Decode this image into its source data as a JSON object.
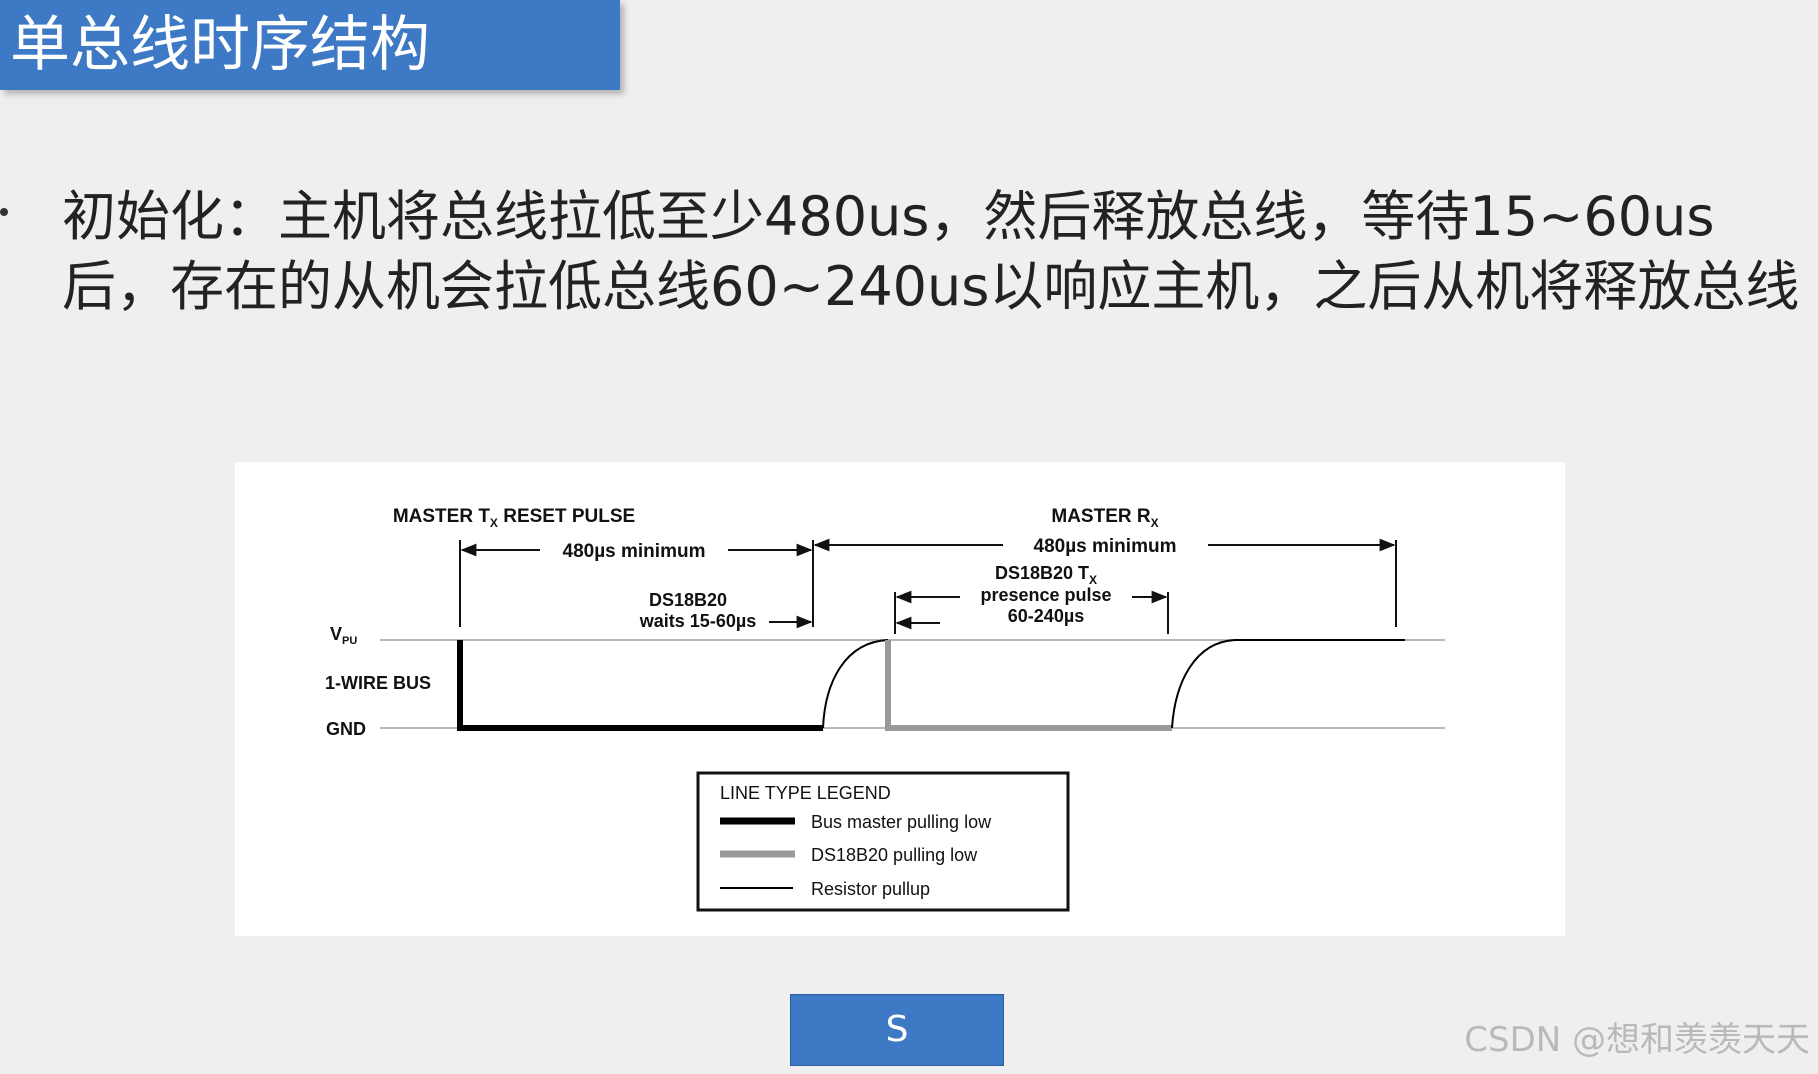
{
  "slide": {
    "title": "单总线时序结构",
    "bullet_text": "初始化：主机将总线拉低至少480us，然后释放总线，等待15~60us后，存在的从机会拉低总线60~240us以响应主机，之后从机将释放总线"
  },
  "diagram": {
    "master_tx_reset_label": "MASTER T",
    "master_tx_reset_sub": "X",
    "master_tx_reset_rest": " RESET PULSE",
    "master_tx_min": "480µs minimum",
    "master_rx_label": "MASTER R",
    "master_rx_sub": "X",
    "master_rx_min": "480µs minimum",
    "ds_waits_line1": "DS18B20",
    "ds_waits_line2": "waits 15-60µs",
    "ds_tx_label": "DS18B20 T",
    "ds_tx_sub": "X",
    "ds_presence": "presence pulse",
    "ds_presence_range": "60-240µs",
    "vpu_label": "V",
    "vpu_sub": "PU",
    "bus_label": "1-WIRE BUS",
    "gnd_label": "GND",
    "legend": {
      "title": "LINE TYPE LEGEND",
      "items": [
        {
          "label": "Bus master pulling low",
          "color": "#000000"
        },
        {
          "label": "DS18B20 pulling low",
          "color": "#9a9a9a"
        },
        {
          "label": "Resistor pullup",
          "color": "#000000"
        }
      ]
    }
  },
  "button": {
    "label": "S"
  },
  "watermark": {
    "text": "CSDN @想和羡羡天天"
  },
  "colors": {
    "title_bar": "#3d79c4",
    "background": "#efefef"
  }
}
